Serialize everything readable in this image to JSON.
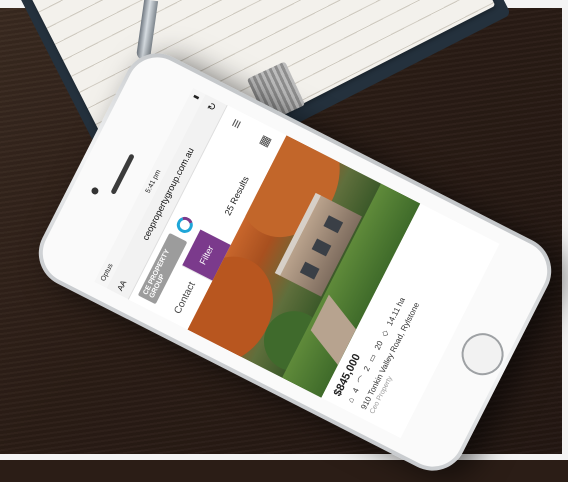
{
  "status": {
    "carrier": "Optus",
    "time": "5:41 pm",
    "battery": "▮"
  },
  "browser": {
    "text_size": "AA",
    "url": "ceopropertygroup.com.au",
    "reload": "↻"
  },
  "site": {
    "logo_text": "CE PROPERTY GROUP",
    "menu": "≡"
  },
  "toolbar": {
    "contact": "Contact",
    "filter": "Filter",
    "results": "25 Results",
    "grid": "▦"
  },
  "listing": {
    "price": "$845,000",
    "beds": "4",
    "baths": "2",
    "cars": "20",
    "land": "14.11 ha",
    "address": "910 Tonkin Valley Road, Rylstone",
    "agency": "Ceo Property"
  },
  "colors": {
    "accent": "#7b3a8c",
    "brand_blue": "#1fa6d8"
  }
}
